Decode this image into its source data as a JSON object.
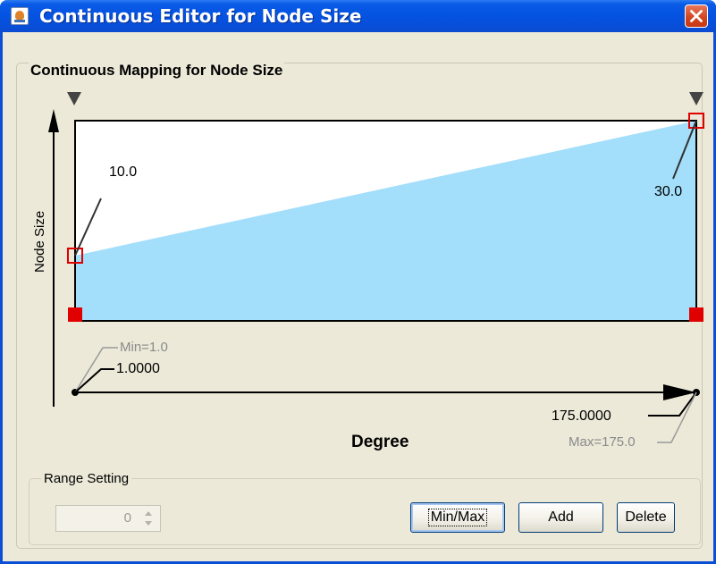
{
  "window": {
    "title": "Continuous Editor for Node Size"
  },
  "panel": {
    "title": "Continuous Mapping for Node Size"
  },
  "graph": {
    "y_axis_label": "Node Size",
    "x_axis_label": "Degree",
    "point_left_value": "10.0",
    "point_right_value": "30.0",
    "min_label": "Min=1.0",
    "min_value": "1.0000",
    "max_label": "Max=175.0",
    "max_value": "175.0000"
  },
  "range_setting": {
    "title": "Range Setting",
    "spinner_value": "0"
  },
  "buttons": {
    "minmax": "Min/Max",
    "add": "Add",
    "delete": "Delete"
  },
  "colors": {
    "fill": "#a3defa",
    "handle": "#e00000",
    "title_bar": "#0554e3"
  },
  "icons": {
    "app": "java-cup-icon",
    "close": "close-x-icon",
    "spin_up": "spin-up-icon",
    "spin_down": "spin-down-icon"
  }
}
